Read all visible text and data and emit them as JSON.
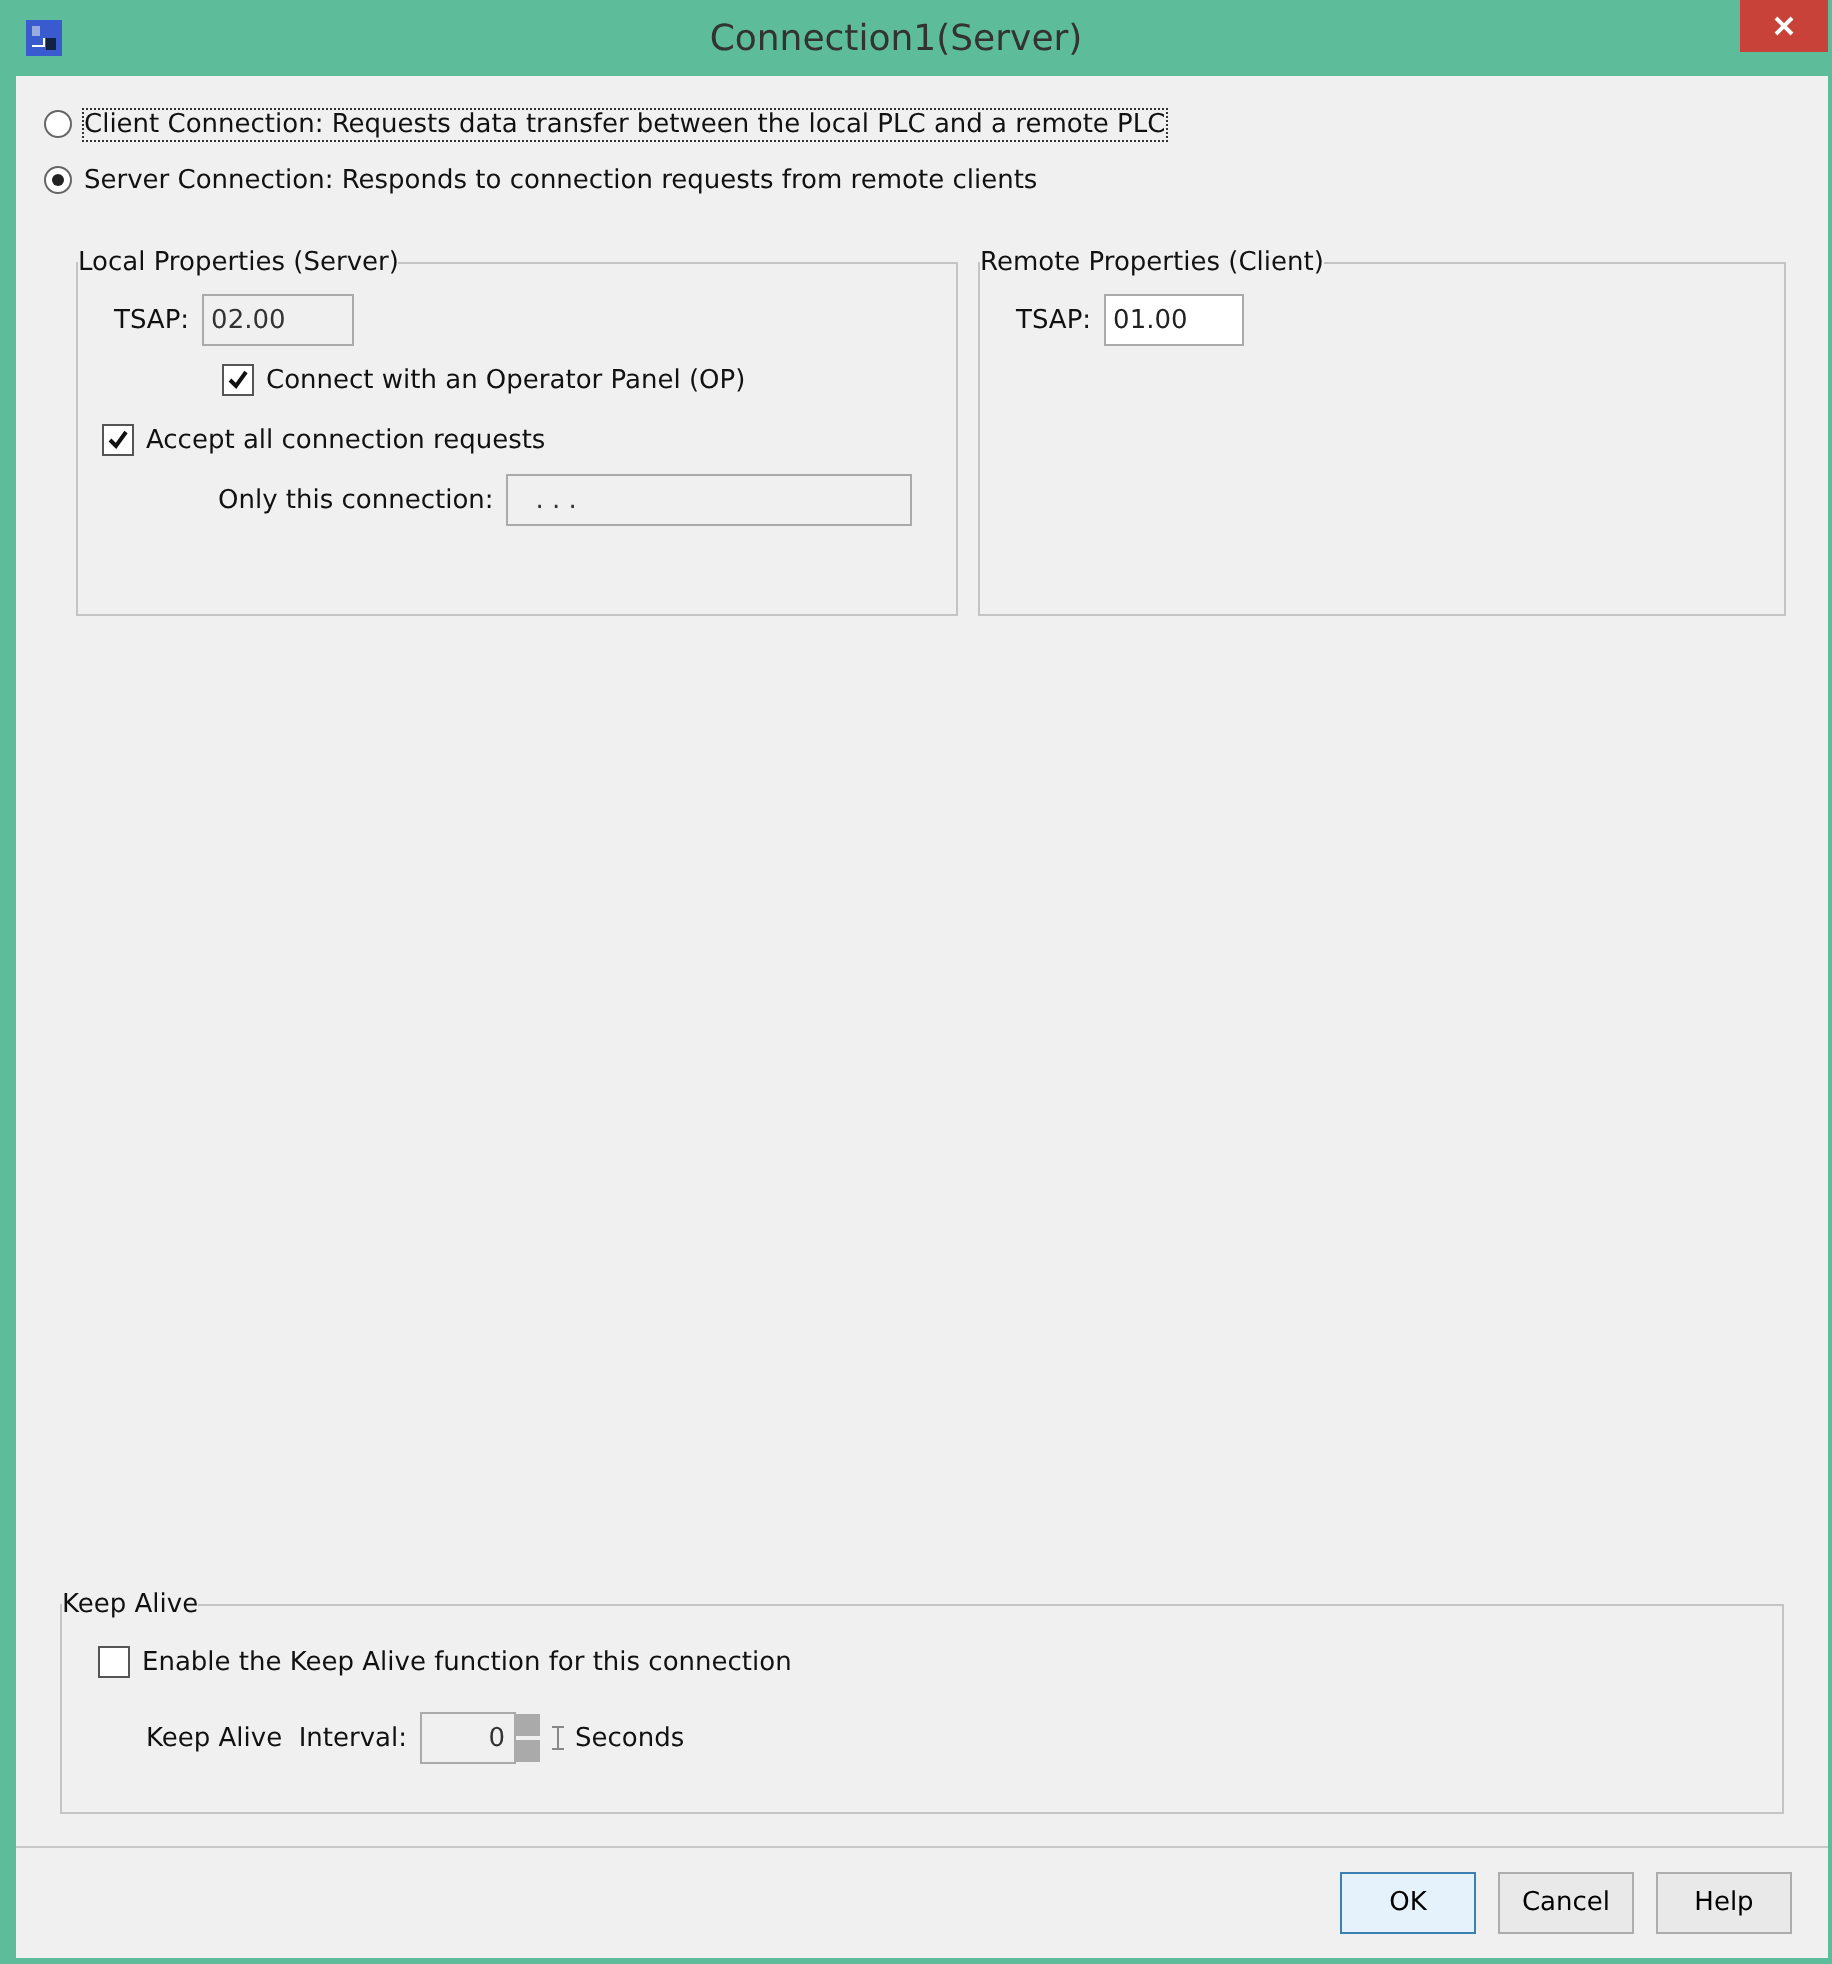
{
  "window": {
    "title": "Connection1(Server)"
  },
  "connection_types": [
    {
      "label": "Client Connection: Requests data transfer between the local PLC and a remote PLC",
      "selected": false,
      "focused": true
    },
    {
      "label": "Server Connection: Responds to connection requests from remote clients",
      "selected": true,
      "focused": false
    }
  ],
  "local": {
    "title": "Local Properties (Server)",
    "tsap_label": "TSAP:",
    "tsap_value": "02.00",
    "tsap_disabled": true,
    "op_checkbox": {
      "label": "Connect with an Operator Panel (OP)",
      "checked": true
    },
    "accept_checkbox": {
      "label": "Accept all connection requests",
      "checked": true
    },
    "only_label": "Only this connection:",
    "only_value": ". . .",
    "only_disabled": true
  },
  "remote": {
    "title": "Remote Properties (Client)",
    "tsap_label": "TSAP:",
    "tsap_value": "01.00",
    "tsap_disabled": false
  },
  "keep_alive": {
    "title": "Keep Alive",
    "enable": {
      "label": "Enable the Keep Alive function for this connection",
      "checked": false
    },
    "interval_label": "Keep Alive  Interval:",
    "interval_value": "0",
    "interval_disabled": true,
    "unit": "Seconds"
  },
  "buttons": [
    {
      "label": "OK",
      "default": true
    },
    {
      "label": "Cancel",
      "default": false
    },
    {
      "label": "Help",
      "default": false
    }
  ]
}
